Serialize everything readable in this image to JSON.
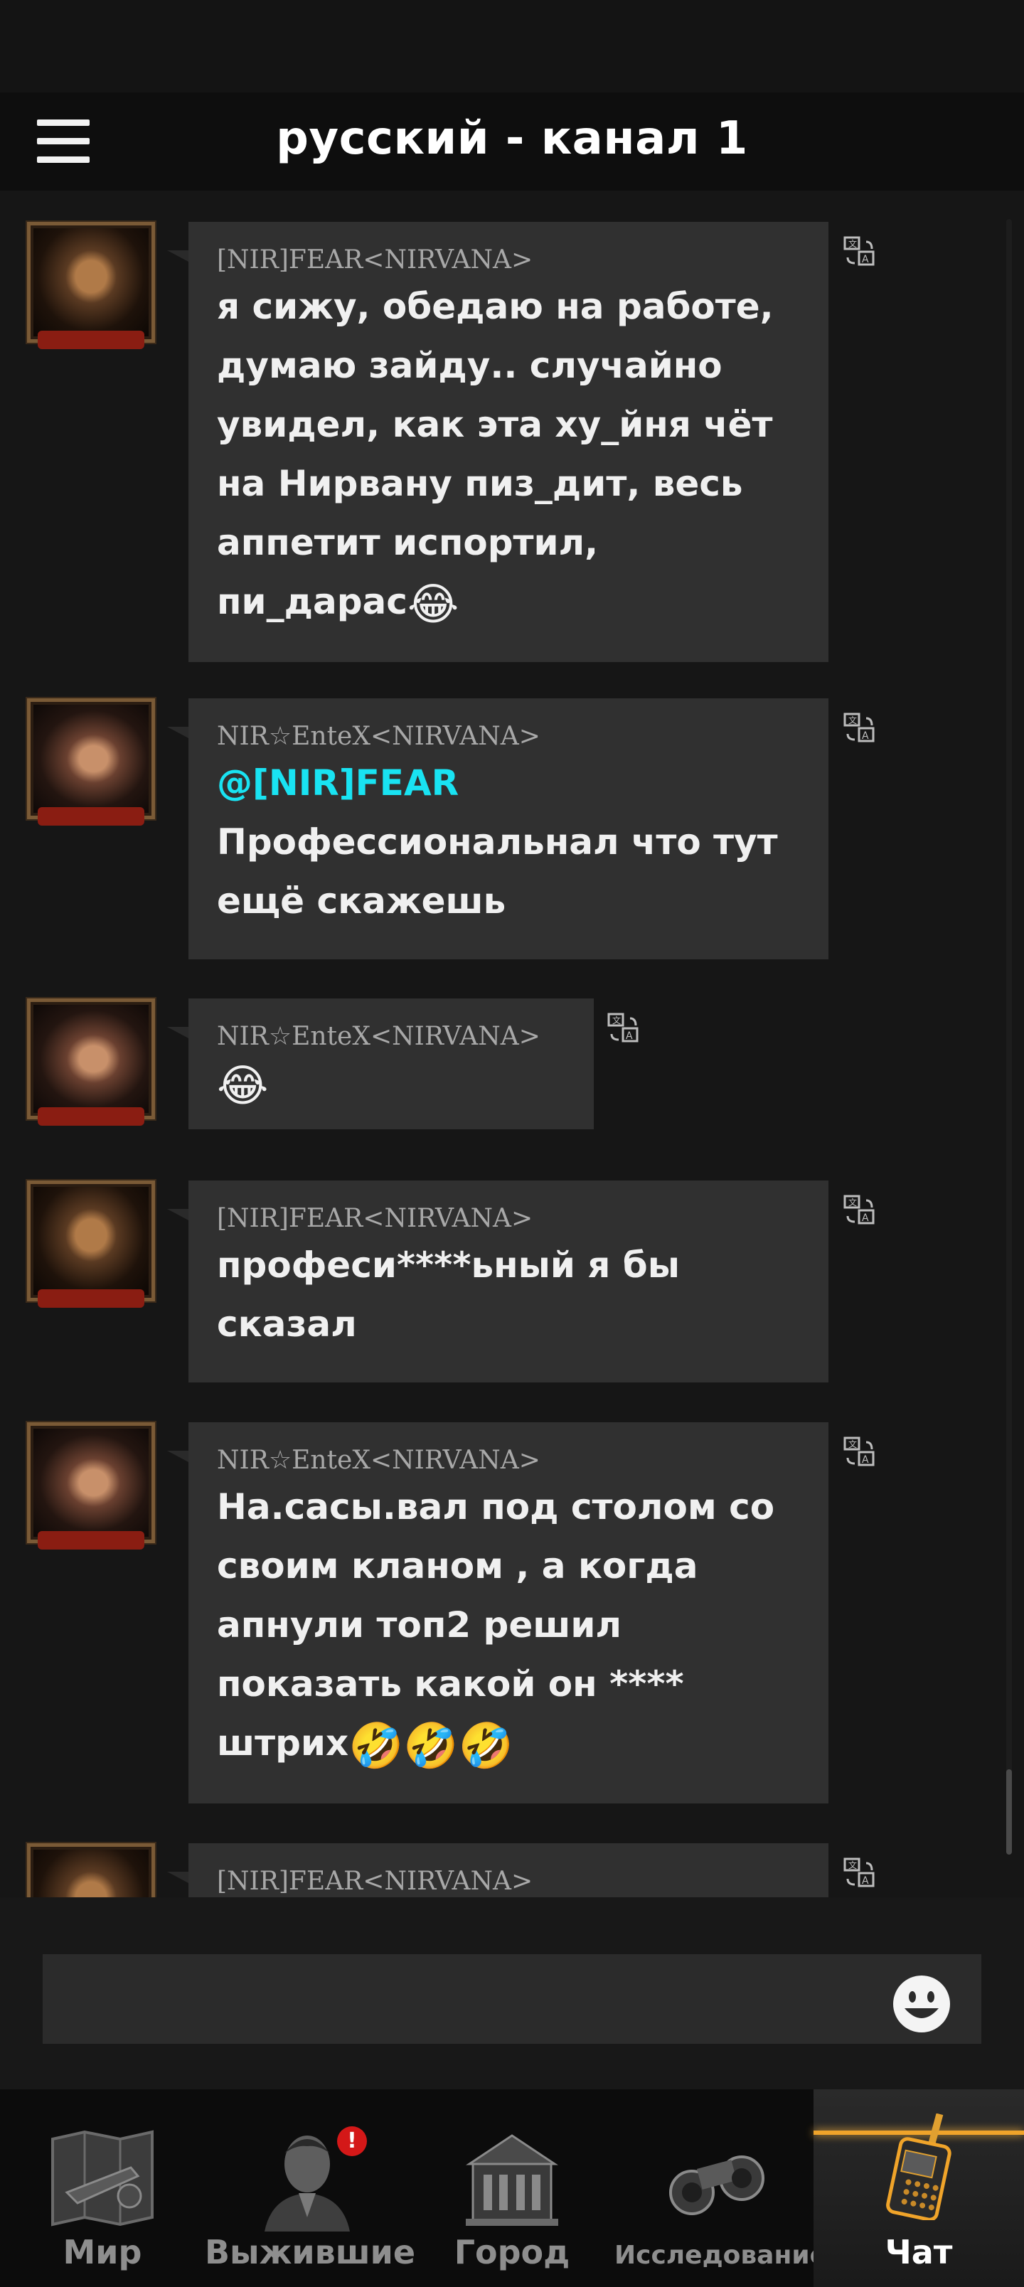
{
  "header": {
    "title": "русский - канал 1"
  },
  "messages": [
    {
      "sender": "[NIR]FEAR<NIRVANA>",
      "avatar": "fear",
      "text": "я сижу, обедаю на работе,\nдумаю зайду.. случайно\nувидел, как эта ху_йня чёт\nна Нирвану пиз_дит, весь\nаппетит испортил,\nпи_дарас",
      "emoji": "😂",
      "mention": ""
    },
    {
      "sender": "NIR☆EnteX<NIRVANA>",
      "avatar": "entex",
      "mention": "@[NIR]FEAR",
      "text": "Профессиональнал что тут\nещё скажешь",
      "emoji": ""
    },
    {
      "sender": "NIR☆EnteX<NIRVANA>",
      "avatar": "entex",
      "mention": "",
      "text": "",
      "emoji": "😂"
    },
    {
      "sender": "[NIR]FEAR<NIRVANA>",
      "avatar": "fear",
      "mention": "",
      "text": "професи****ьный я бы\nсказал",
      "emoji": ""
    },
    {
      "sender": "NIR☆EnteX<NIRVANA>",
      "avatar": "entex",
      "mention": "",
      "text": "На.сасы.вал под столом со\nсвоим кланом , а когда\nапнули топ2 решил\nпоказать какой он ****\nштрих",
      "emoji": "🤣🤣🤣"
    },
    {
      "sender": "[NIR]FEAR<NIRVANA>",
      "avatar": "fear",
      "mention": "",
      "text": "",
      "emoji": ""
    }
  ],
  "input": {
    "value": "",
    "placeholder": ""
  },
  "nav": {
    "items": [
      {
        "label": "Мир",
        "icon": "world-map-icon"
      },
      {
        "label": "Выжившие",
        "icon": "survivor-icon",
        "badge": "!"
      },
      {
        "label": "Город",
        "icon": "city-building-icon"
      },
      {
        "label": "Исследование",
        "icon": "binoculars-icon"
      },
      {
        "label": "Чат",
        "icon": "walkie-talkie-icon",
        "active": true
      }
    ]
  },
  "colors": {
    "accent": "#f0a42a",
    "mention": "#19e3f2",
    "bubble": "#303030",
    "badge": "#d41818"
  }
}
